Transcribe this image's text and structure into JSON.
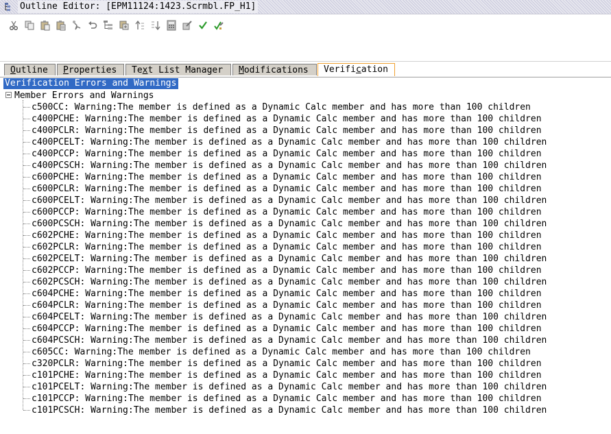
{
  "window": {
    "title": "Outline Editor: [EPM11124:1423.Scrmbl.FP_H1]"
  },
  "toolbar": {
    "buttons": [
      {
        "name": "cut-icon"
      },
      {
        "name": "copy-icon"
      },
      {
        "name": "paste-icon"
      },
      {
        "name": "paste-special-icon"
      },
      {
        "name": "find-icon"
      },
      {
        "name": "undo-icon"
      },
      {
        "name": "outline-tree-icon"
      },
      {
        "name": "add-child-icon"
      },
      {
        "name": "sort-ascending-icon"
      },
      {
        "name": "sort-descending-icon"
      },
      {
        "name": "calculator-icon"
      },
      {
        "name": "edit-properties-icon"
      },
      {
        "name": "verify-check-icon"
      },
      {
        "name": "save-verify-icon"
      }
    ]
  },
  "tabs": [
    {
      "mnemonic": "O",
      "rest": "utline"
    },
    {
      "mnemonic": "P",
      "rest": "roperties"
    },
    {
      "prefix": "Te",
      "mnemonic": "x",
      "rest": "t List Manager"
    },
    {
      "mnemonic": "M",
      "rest": "odifications"
    },
    {
      "prefix": "Verifi",
      "mnemonic": "c",
      "rest": "ation"
    }
  ],
  "content": {
    "header": "Verification Errors and Warnings",
    "group_label": "Member Errors and Warnings",
    "items": [
      "c500CC: Warning:The member is defined as a Dynamic Calc member and has more than 100 children",
      "c400PCHE: Warning:The member is defined as a Dynamic Calc member and has more than 100 children",
      "c400PCLR: Warning:The member is defined as a Dynamic Calc member and has more than 100 children",
      "c400PCELT: Warning:The member is defined as a Dynamic Calc member and has more than 100 children",
      "c400PCCP: Warning:The member is defined as a Dynamic Calc member and has more than 100 children",
      "c400PCSCH: Warning:The member is defined as a Dynamic Calc member and has more than 100 children",
      "c600PCHE: Warning:The member is defined as a Dynamic Calc member and has more than 100 children",
      "c600PCLR: Warning:The member is defined as a Dynamic Calc member and has more than 100 children",
      "c600PCELT: Warning:The member is defined as a Dynamic Calc member and has more than 100 children",
      "c600PCCP: Warning:The member is defined as a Dynamic Calc member and has more than 100 children",
      "c600PCSCH: Warning:The member is defined as a Dynamic Calc member and has more than 100 children",
      "c602PCHE: Warning:The member is defined as a Dynamic Calc member and has more than 100 children",
      "c602PCLR: Warning:The member is defined as a Dynamic Calc member and has more than 100 children",
      "c602PCELT: Warning:The member is defined as a Dynamic Calc member and has more than 100 children",
      "c602PCCP: Warning:The member is defined as a Dynamic Calc member and has more than 100 children",
      "c602PCSCH: Warning:The member is defined as a Dynamic Calc member and has more than 100 children",
      "c604PCHE: Warning:The member is defined as a Dynamic Calc member and has more than 100 children",
      "c604PCLR: Warning:The member is defined as a Dynamic Calc member and has more than 100 children",
      "c604PCELT: Warning:The member is defined as a Dynamic Calc member and has more than 100 children",
      "c604PCCP: Warning:The member is defined as a Dynamic Calc member and has more than 100 children",
      "c604PCSCH: Warning:The member is defined as a Dynamic Calc member and has more than 100 children",
      "c605CC: Warning:The member is defined as a Dynamic Calc member and has more than 100 children",
      "c320PCLR: Warning:The member is defined as a Dynamic Calc member and has more than 100 children",
      "c101PCHE: Warning:The member is defined as a Dynamic Calc member and has more than 100 children",
      "c101PCELT: Warning:The member is defined as a Dynamic Calc member and has more than 100 children",
      "c101PCCP: Warning:The member is defined as a Dynamic Calc member and has more than 100 children",
      "c101PCSCH: Warning:The member is defined as a Dynamic Calc member and has more than 100 children"
    ]
  },
  "colors": {
    "selection": "#316ac5",
    "active_tab_border": "#f0a030",
    "tab_background": "#d4d0c8"
  }
}
